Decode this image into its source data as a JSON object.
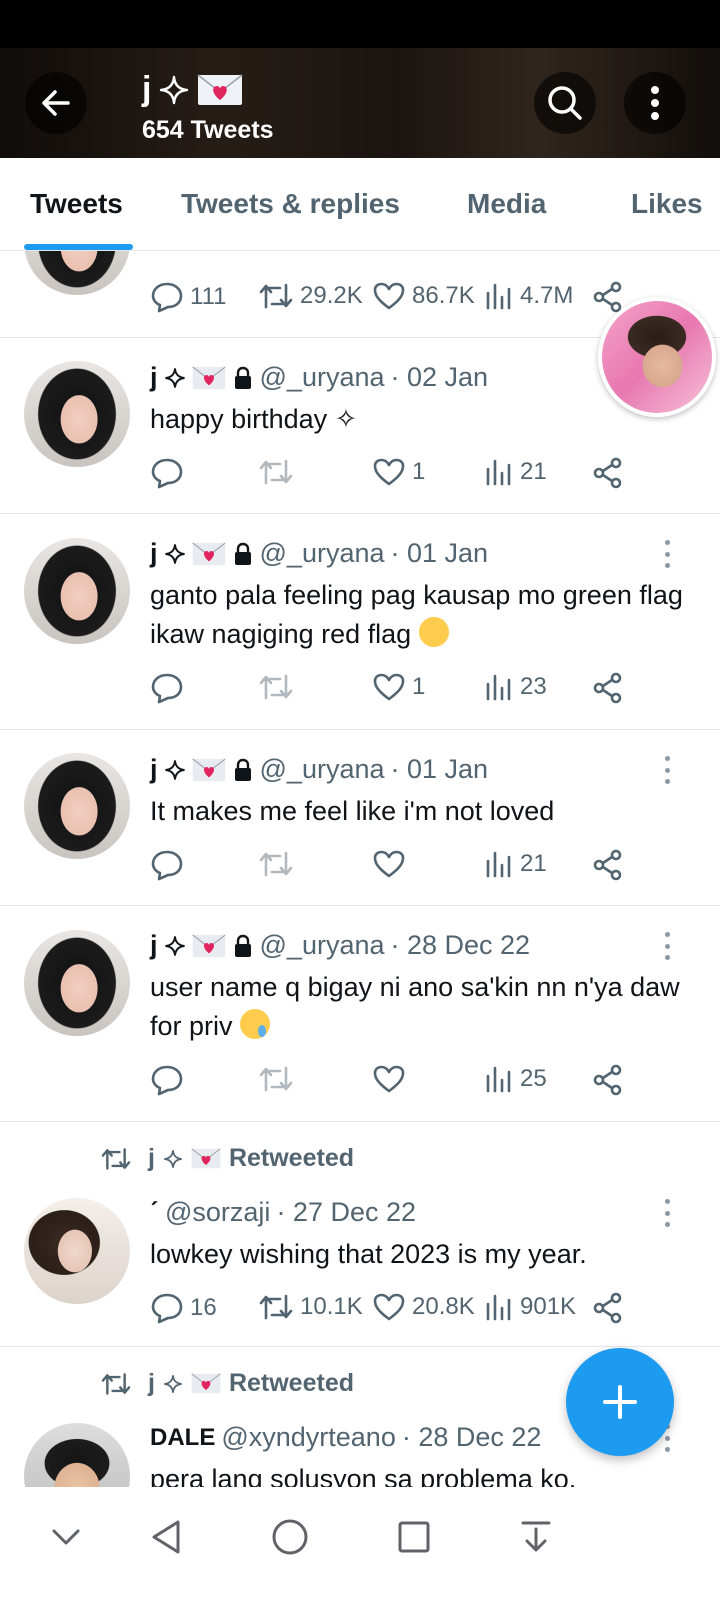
{
  "header": {
    "name": "j",
    "tweet_count": "654 Tweets"
  },
  "tabs": [
    {
      "label": "Tweets"
    },
    {
      "label": "Tweets & replies"
    },
    {
      "label": "Media"
    },
    {
      "label": "Likes"
    }
  ],
  "partial_tweet": {
    "replies": "111",
    "retweets": "29.2K",
    "likes": "86.7K",
    "views": "4.7M"
  },
  "tweets": [
    {
      "name": "j",
      "handle": "@_uryana",
      "date": "· 02 Jan",
      "text": "happy birthday ✧",
      "replies": "",
      "retweets": "",
      "likes": "1",
      "views": "21"
    },
    {
      "name": "j",
      "handle": "@_uryana",
      "date": "· 01 Jan",
      "text": "ganto pala feeling pag kausap mo green flag ikaw nagiging red flag",
      "replies": "",
      "retweets": "",
      "likes": "1",
      "views": "23"
    },
    {
      "name": "j",
      "handle": "@_uryana",
      "date": "· 01 Jan",
      "text": "It makes me feel like i'm not loved",
      "replies": "",
      "retweets": "",
      "likes": "",
      "views": "21"
    },
    {
      "name": "j",
      "handle": "@_uryana",
      "date": "· 28 Dec 22",
      "text": "user name q bigay ni ano sa'kin nn n'ya daw for priv",
      "replies": "",
      "retweets": "",
      "likes": "",
      "views": "25"
    }
  ],
  "retweets": [
    {
      "retweeted_by": "j",
      "retweeted_label": "Retweeted",
      "display_name": "ˊ",
      "handle": "@sorzaji",
      "date": "· 27 Dec 22",
      "text": "lowkey wishing that 2023 is my year.",
      "replies": "16",
      "retweets": "10.1K",
      "likes": "20.8K",
      "views": "901K"
    },
    {
      "retweeted_by": "j",
      "retweeted_label": "Retweeted",
      "display_name": "DALE",
      "handle": "@xyndyrteano",
      "date": "· 28 Dec 22",
      "text": "pera lang solusyon sa problema ko."
    }
  ],
  "icons": {
    "accent": "#1d9bf0",
    "muted": "#536471"
  }
}
